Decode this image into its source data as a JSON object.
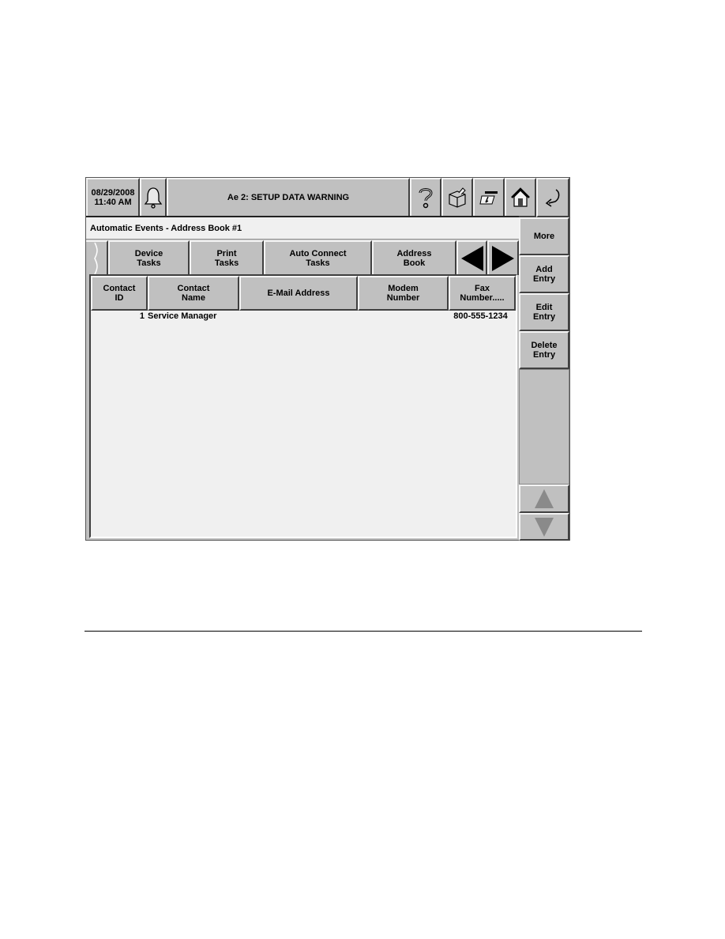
{
  "topbar": {
    "date": "08/29/2008",
    "time": "11:40 AM",
    "alarm_message": "Ae 2: SETUP DATA WARNING",
    "icons": [
      "bell-icon",
      "help-icon",
      "supplies-icon",
      "print-screen-icon",
      "home-icon",
      "back-icon"
    ]
  },
  "breadcrumb": "Automatic Events - Address Book #1",
  "tabs": [
    {
      "line1": "Device",
      "line2": "Tasks"
    },
    {
      "line1": "Print",
      "line2": "Tasks"
    },
    {
      "line1": "Auto Connect",
      "line2": "Tasks"
    },
    {
      "line1": "Address",
      "line2": "Book"
    }
  ],
  "table": {
    "columns": [
      {
        "line1": "Contact",
        "line2": "ID"
      },
      {
        "line1": "Contact",
        "line2": "Name"
      },
      {
        "line1": "E-Mail Address",
        "line2": ""
      },
      {
        "line1": "Modem",
        "line2": "Number"
      },
      {
        "line1": "Fax",
        "line2": "Number....."
      }
    ],
    "rows": [
      {
        "id": "1",
        "name": "Service Manager",
        "email": "",
        "modem": "",
        "fax": "800-555-1234"
      }
    ]
  },
  "sidebar": {
    "buttons": [
      {
        "line1": "More",
        "line2": ""
      },
      {
        "line1": "Add",
        "line2": "Entry"
      },
      {
        "line1": "Edit",
        "line2": "Entry"
      },
      {
        "line1": "Delete",
        "line2": "Entry"
      }
    ]
  }
}
